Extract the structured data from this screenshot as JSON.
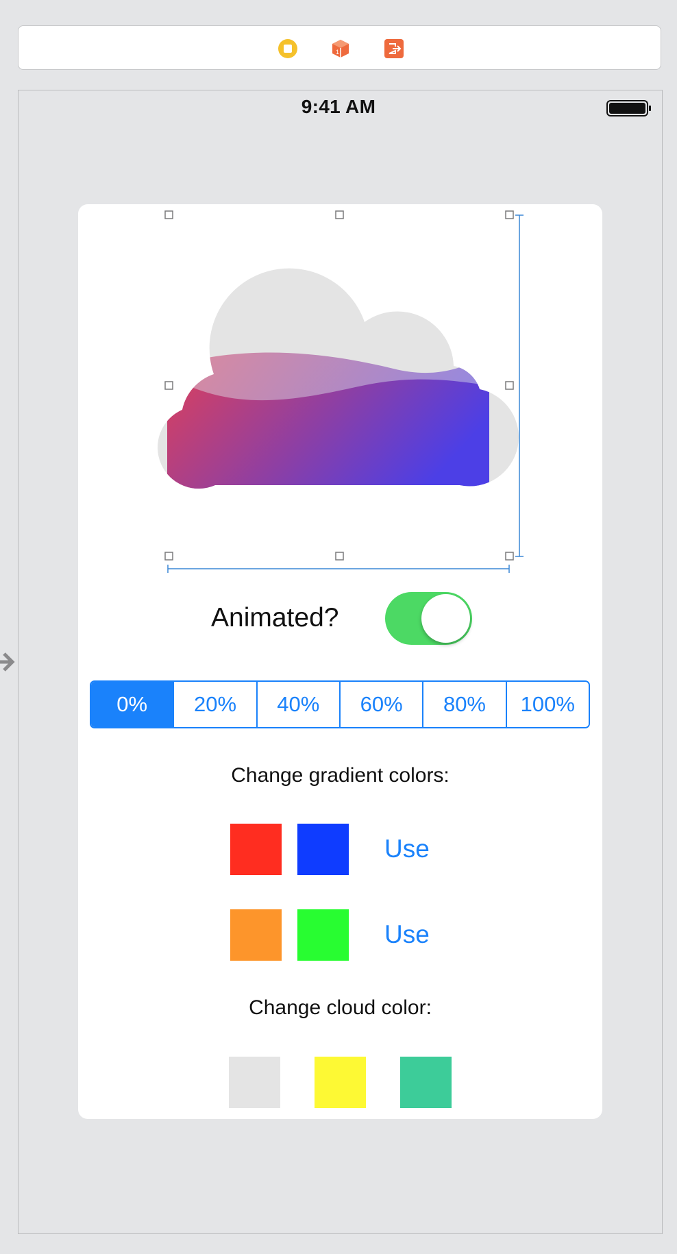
{
  "toolbar": {
    "icons": [
      "view-controller-icon",
      "first-responder-icon",
      "exit-icon"
    ],
    "colors": {
      "yellow": "#f5c12b",
      "orange": "#ee6a3d"
    }
  },
  "status_bar": {
    "time": "9:41 AM"
  },
  "cloud": {
    "base_color": "#e4e4e4",
    "gradient_start": "#d8415f",
    "gradient_end": "#4c3fe6"
  },
  "animated": {
    "label": "Animated?",
    "on": true,
    "tint": "#4cd964"
  },
  "progress_segments": {
    "options": [
      "0%",
      "20%",
      "40%",
      "60%",
      "80%",
      "100%"
    ],
    "selected_index": 0,
    "accent": "#1a82fb"
  },
  "gradient_section": {
    "title": "Change gradient colors:",
    "rows": [
      {
        "color_a": "#ff2d20",
        "color_b": "#0f3cff",
        "action_label": "Use"
      },
      {
        "color_a": "#fd952b",
        "color_b": "#28fd31",
        "action_label": "Use"
      }
    ]
  },
  "cloud_color_section": {
    "title": "Change cloud color:",
    "swatches": [
      "#e4e4e4",
      "#fdf934",
      "#3dcc99"
    ]
  }
}
